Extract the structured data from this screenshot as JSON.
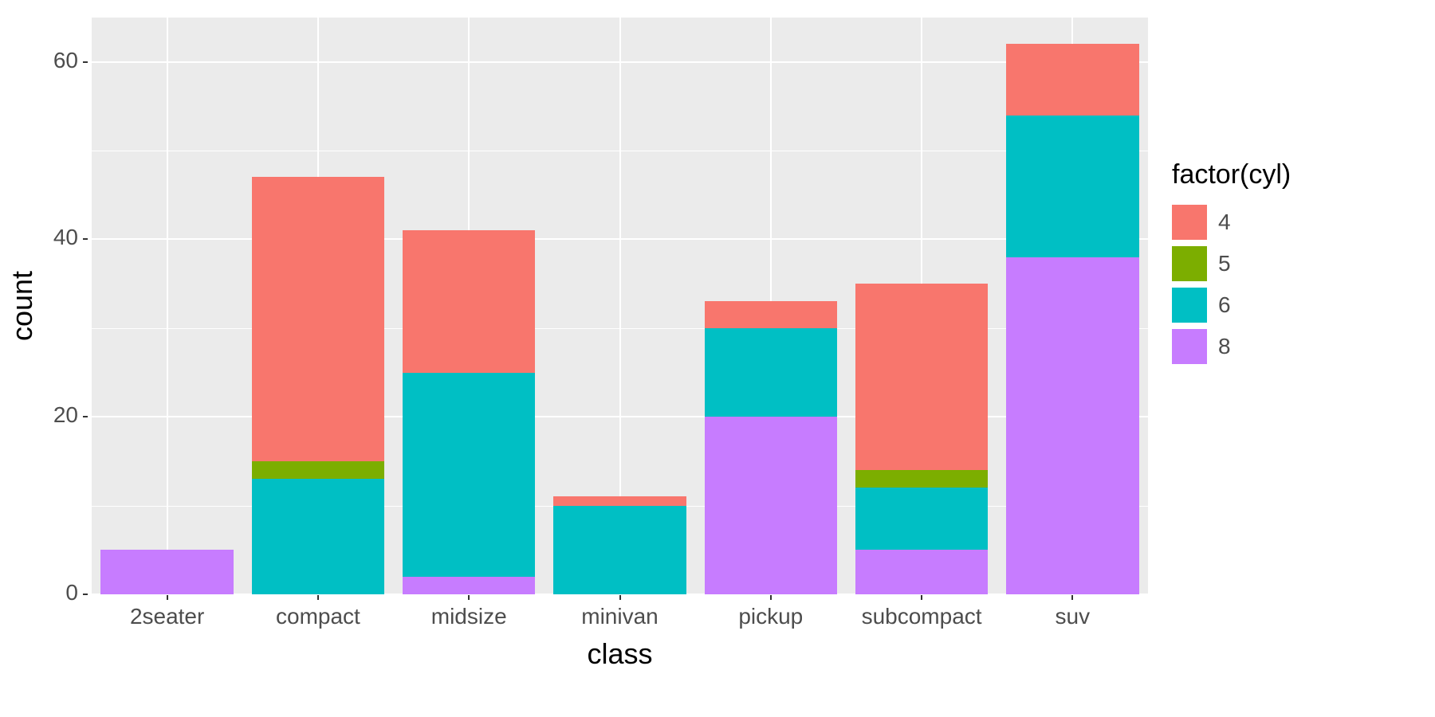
{
  "chart_data": {
    "type": "bar",
    "stacked": true,
    "categories": [
      "2seater",
      "compact",
      "midsize",
      "minivan",
      "pickup",
      "subcompact",
      "suv"
    ],
    "series": [
      {
        "name": "4",
        "color": "#F8766D",
        "values": [
          0,
          32,
          16,
          1,
          3,
          21,
          8
        ]
      },
      {
        "name": "5",
        "color": "#7CAE00",
        "values": [
          0,
          2,
          0,
          0,
          0,
          2,
          0
        ]
      },
      {
        "name": "6",
        "color": "#00BFC4",
        "values": [
          0,
          13,
          23,
          10,
          10,
          7,
          16
        ]
      },
      {
        "name": "8",
        "color": "#C77CFF",
        "values": [
          5,
          0,
          2,
          0,
          20,
          5,
          38
        ]
      }
    ],
    "stack_order": [
      "8",
      "6",
      "5",
      "4"
    ],
    "xlabel": "class",
    "ylabel": "count",
    "ylim": [
      0,
      65
    ],
    "y_ticks": [
      0,
      20,
      40,
      60
    ],
    "y_minor_ticks": [
      10,
      30,
      50
    ],
    "legend_title": "factor(cyl)",
    "grid": true,
    "legend_position": "right"
  }
}
